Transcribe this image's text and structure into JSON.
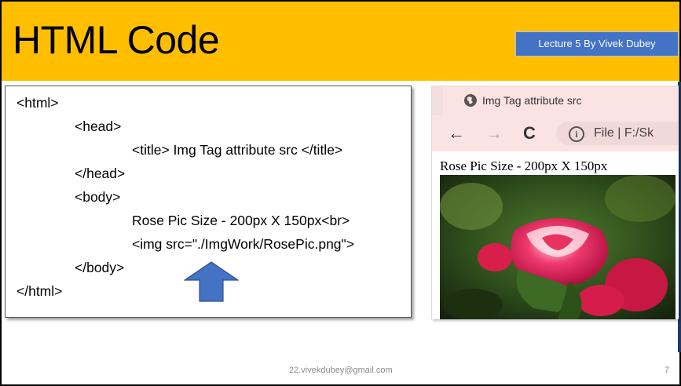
{
  "slide": {
    "title": "HTML Code",
    "lecture_label": "Lecture 5 By Vivek Dubey",
    "footer_email": "22.vivekdubey@gmail.com",
    "page_number": "7"
  },
  "code": {
    "lines": [
      "<html>",
      "<head>",
      "<title> Img Tag attribute src </title>",
      "</head>",
      "<body>",
      "Rose Pic Size - 200px X 150px<br>",
      "<img src=\"./ImgWork/RosePic.png\">",
      "</body>",
      "</html>"
    ]
  },
  "browser": {
    "tab_title": "Img Tag attribute src",
    "back_icon": "←",
    "forward_icon": "→",
    "reload_icon": "C",
    "info_icon": "i",
    "address_text": "File  |  F:/Sk",
    "page_text": "Rose Pic Size - 200px X 150px"
  },
  "colors": {
    "header_bg": "#ffbf00",
    "lecture_bg": "#4472c4",
    "arrow": "#4472c4",
    "tab_bg": "#fbe3e4"
  }
}
